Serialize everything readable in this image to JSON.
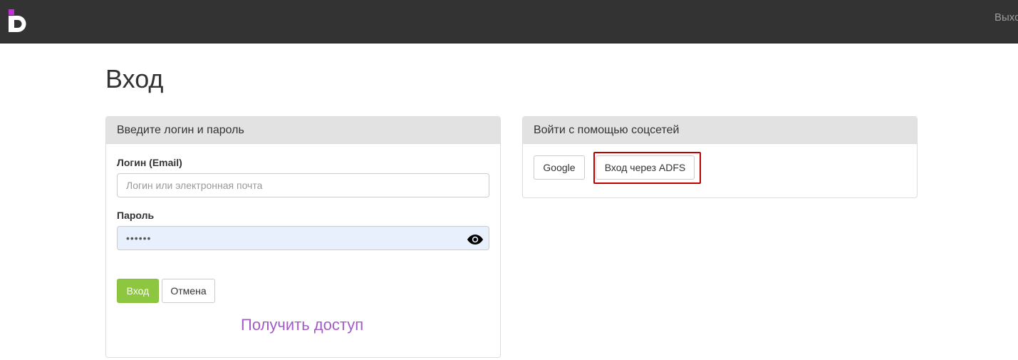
{
  "navbar": {
    "logo_icon": "brand-d-logo",
    "exit_label": "Выход"
  },
  "page": {
    "title": "Вход"
  },
  "login_panel": {
    "heading": "Введите логин и пароль",
    "login_label": "Логин (Email)",
    "login_placeholder": "Логин или электронная почта",
    "password_label": "Пароль",
    "password_value": "••••••",
    "eye_icon": "eye-icon",
    "submit_label": "Вход",
    "cancel_label": "Отмена",
    "access_link": "Получить доступ"
  },
  "social_panel": {
    "heading": "Войти с помощью соцсетей",
    "google_label": "Google",
    "adfs_label": "Вход через ADFS"
  },
  "colors": {
    "navbar": "#333333",
    "success": "#8dc63f",
    "link": "#a35bc6",
    "highlight": "#c00000",
    "logo_accent": "#c22fd6"
  }
}
